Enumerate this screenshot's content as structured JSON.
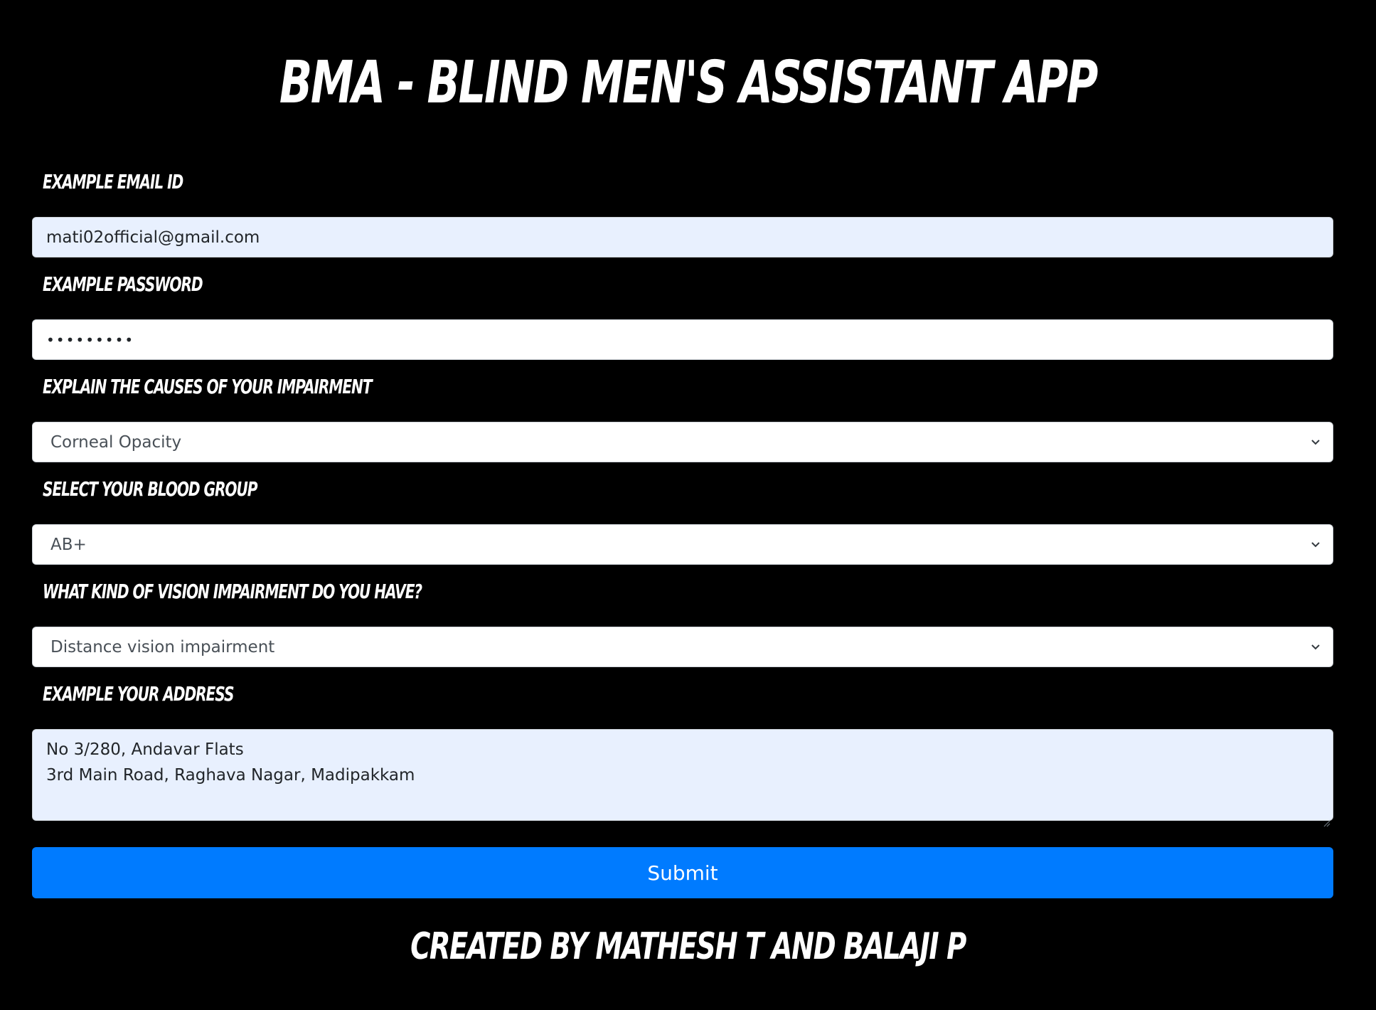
{
  "header": {
    "title": "BMA - BLIND MEN'S ASSISTANT APP"
  },
  "form": {
    "email": {
      "label": "Example Email ID",
      "value": "mati02official@gmail.com"
    },
    "password": {
      "label": "Example Password",
      "masked_value": "•••••••••"
    },
    "cause": {
      "label": "Explain the causes of your impairment",
      "selected": "Corneal Opacity"
    },
    "blood_group": {
      "label": "Select your blood group",
      "selected": "AB+"
    },
    "vision_type": {
      "label": "What kind of vision impairment do you have?",
      "selected": "Distance vision impairment"
    },
    "address": {
      "label": "Example Your Address",
      "line1": "No 3/280, Andavar Flats",
      "line2": "3rd Main Road, Raghava Nagar, Madipakkam"
    },
    "submit_label": "Submit"
  },
  "footer": {
    "credit": "Created by Mathesh T and Balaji P"
  },
  "colors": {
    "background": "#000000",
    "primary": "#007bff",
    "autofill": "#e8f0fe"
  },
  "icons": {
    "select_arrow": "chevron-down-icon",
    "resize": "resize-grip-icon"
  }
}
